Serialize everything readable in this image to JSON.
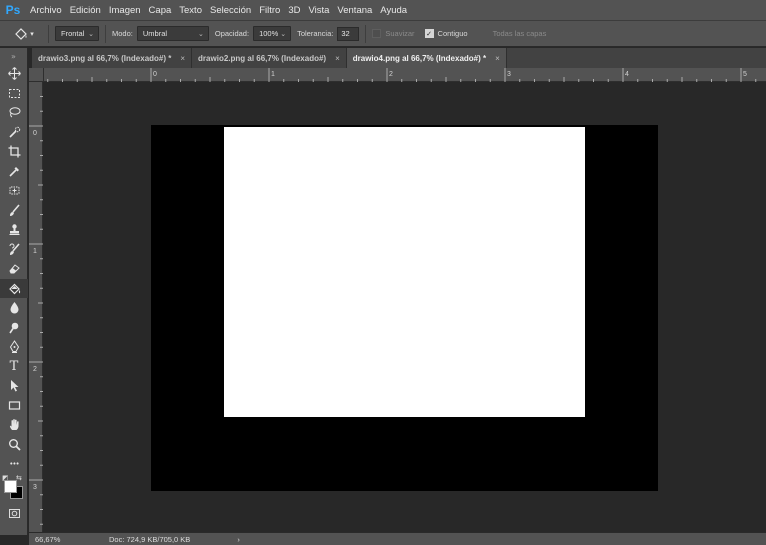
{
  "app": {
    "logo": "Ps"
  },
  "menu": [
    "Archivo",
    "Edición",
    "Imagen",
    "Capa",
    "Texto",
    "Selección",
    "Filtro",
    "3D",
    "Vista",
    "Ventana",
    "Ayuda"
  ],
  "options": {
    "tool_icon": "paint-bucket-icon",
    "fill_select": "Frontal",
    "mode_label": "Modo:",
    "mode_value": "Umbral",
    "opacity_label": "Opacidad:",
    "opacity_value": "100%",
    "tolerance_label": "Tolerancia:",
    "tolerance_value": "32",
    "antialias_label": "Suavizar",
    "antialias_checked": false,
    "contiguous_label": "Contiguo",
    "contiguous_checked": true,
    "all_layers_label": "Todas las capas",
    "all_layers_checked": false
  },
  "tabs": [
    {
      "label": "drawio3.png al 66,7% (Indexado#) *",
      "active": false
    },
    {
      "label": "drawio2.png al 66,7% (Indexado#)",
      "active": false
    },
    {
      "label": "drawio4.png al 66,7% (Indexado#) *",
      "active": true
    }
  ],
  "tab_close_glyph": "×",
  "ruler": {
    "top_labels": [
      "0",
      "1",
      "2",
      "3",
      "4",
      "5"
    ],
    "left_labels": [
      "0",
      "1",
      "2",
      "3"
    ]
  },
  "tools": [
    "move-icon",
    "marquee-icon",
    "lasso-icon",
    "quick-selection-icon",
    "crop-icon",
    "eyedropper-icon",
    "healing-brush-icon",
    "brush-icon",
    "clone-stamp-icon",
    "history-brush-icon",
    "eraser-icon",
    "paint-bucket-icon",
    "blur-icon",
    "dodge-icon",
    "pen-icon",
    "type-icon",
    "path-selection-icon",
    "rectangle-icon",
    "hand-icon",
    "zoom-icon",
    "more-tools-icon"
  ],
  "active_tool": "paint-bucket-icon",
  "type_tool_glyph": "T",
  "more_tools_glyph": "•••",
  "colors": {
    "foreground": "#ffffff",
    "background": "#000000"
  },
  "status": {
    "zoom": "66,67%",
    "doc": "Doc: 724,9 KB/705,0 KB",
    "arrow": "›"
  }
}
